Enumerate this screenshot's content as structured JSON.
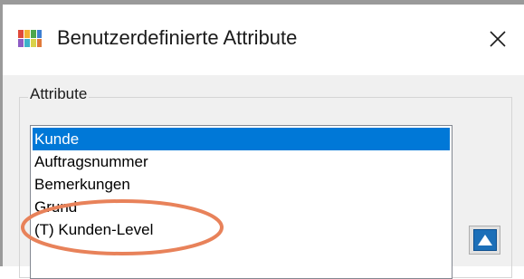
{
  "window": {
    "title": "Benutzerdefinierte Attribute",
    "icon": "app-icon",
    "close_icon": "close-icon",
    "close_glyph": "✕"
  },
  "group": {
    "label": "Attribute"
  },
  "list": {
    "items": [
      {
        "label": "Kunde",
        "selected": true
      },
      {
        "label": "Auftragsnummer",
        "selected": false
      },
      {
        "label": "Bemerkungen",
        "selected": false
      },
      {
        "label": "Grund",
        "selected": false
      },
      {
        "label": "(T) Kunden-Level",
        "selected": false
      }
    ]
  },
  "buttons": {
    "move_up_icon": "arrow-up-icon"
  },
  "colors": {
    "selection": "#0078d7",
    "highlight_ellipse": "#e8825a",
    "up_button": "#1c6fb8"
  }
}
